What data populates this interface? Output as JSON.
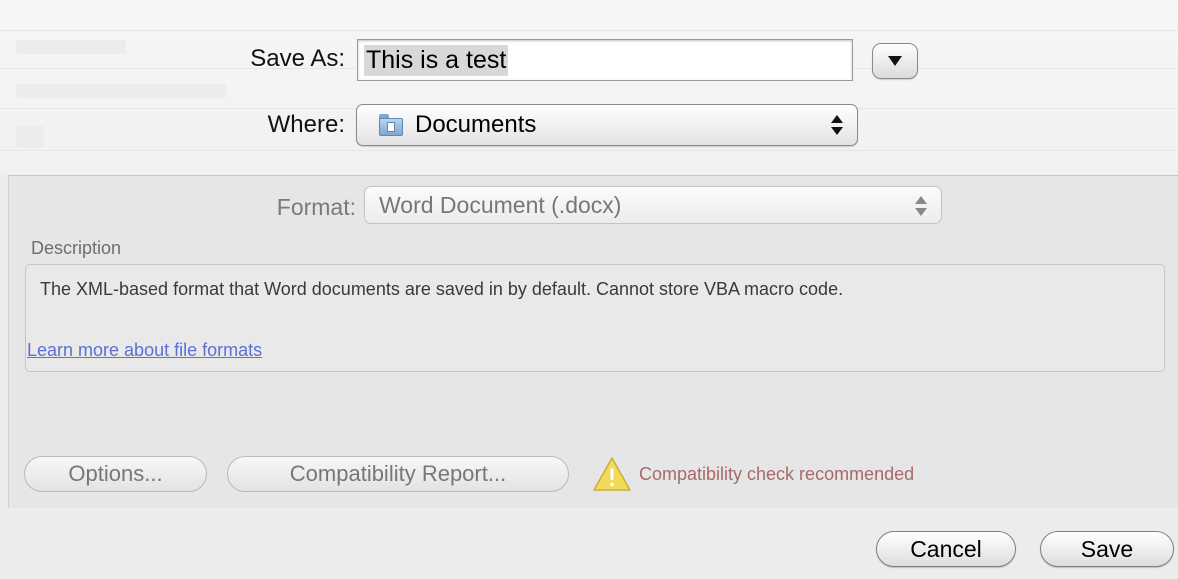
{
  "save_as": {
    "label": "Save As:",
    "value": "This is a test"
  },
  "where": {
    "label": "Where:",
    "value": "Documents",
    "icon": "documents-folder-icon"
  },
  "format": {
    "label": "Format:",
    "value": "Word Document (.docx)"
  },
  "description": {
    "heading": "Description",
    "text": "The XML-based format that Word documents are saved in by default. Cannot store VBA macro code.",
    "link": "Learn more about file formats"
  },
  "buttons": {
    "options": "Options...",
    "compatibility": "Compatibility Report...",
    "cancel": "Cancel",
    "save": "Save"
  },
  "warning": {
    "icon": "warning-triangle-icon",
    "text": "Compatibility check recommended"
  },
  "colors": {
    "link": "#5b6fd6",
    "warning_text": "#a66a6a",
    "warning_icon": "#f2d95b"
  }
}
